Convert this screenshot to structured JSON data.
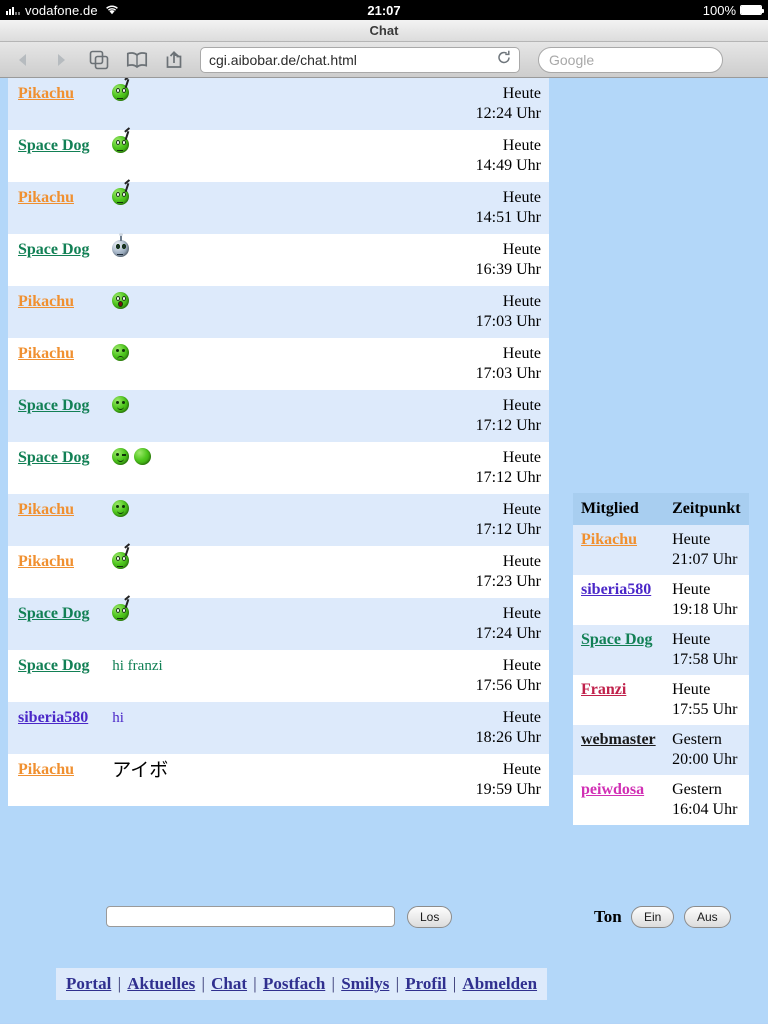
{
  "statusbar": {
    "carrier": "vodafone.de",
    "time": "21:07",
    "battery_percent": "100%",
    "signal_icon": "signal-bars-icon",
    "wifi_icon": "wifi-icon",
    "battery_icon": "battery-full-icon"
  },
  "browser": {
    "title": "Chat",
    "url": "cgi.aibobar.de/chat.html",
    "search_placeholder": "Google",
    "back_icon": "back-arrow-icon",
    "forward_icon": "forward-arrow-icon",
    "tabs_icon": "tabs-icon",
    "bookmarks_icon": "bookmarks-book-icon",
    "share_icon": "share-icon",
    "reload_icon": "reload-icon"
  },
  "chat": {
    "messages": [
      {
        "user": "Pikachu",
        "user_class": "u-pikachu",
        "smileys": [
          "wave"
        ],
        "text": "",
        "text_class": "",
        "day": "Heute",
        "time": "12:24 Uhr"
      },
      {
        "user": "Space Dog",
        "user_class": "u-spacedog",
        "smileys": [
          "wave"
        ],
        "text": "",
        "text_class": "",
        "day": "Heute",
        "time": "14:49 Uhr"
      },
      {
        "user": "Pikachu",
        "user_class": "u-pikachu",
        "smileys": [
          "wave"
        ],
        "text": "",
        "text_class": "",
        "day": "Heute",
        "time": "14:51 Uhr"
      },
      {
        "user": "Space Dog",
        "user_class": "u-spacedog",
        "smileys": [
          "robot"
        ],
        "text": "",
        "text_class": "",
        "day": "Heute",
        "time": "16:39 Uhr"
      },
      {
        "user": "Pikachu",
        "user_class": "u-pikachu",
        "smileys": [
          "shocked"
        ],
        "text": "",
        "text_class": "",
        "day": "Heute",
        "time": "17:03 Uhr"
      },
      {
        "user": "Pikachu",
        "user_class": "u-pikachu",
        "smileys": [
          "sad"
        ],
        "text": "",
        "text_class": "",
        "day": "Heute",
        "time": "17:03 Uhr"
      },
      {
        "user": "Space Dog",
        "user_class": "u-spacedog",
        "smileys": [
          "smile"
        ],
        "text": "",
        "text_class": "",
        "day": "Heute",
        "time": "17:12 Uhr"
      },
      {
        "user": "Space Dog",
        "user_class": "u-spacedog",
        "smileys": [
          "wink",
          "blank"
        ],
        "text": "",
        "text_class": "",
        "day": "Heute",
        "time": "17:12 Uhr"
      },
      {
        "user": "Pikachu",
        "user_class": "u-pikachu",
        "smileys": [
          "smile"
        ],
        "text": "",
        "text_class": "",
        "day": "Heute",
        "time": "17:12 Uhr"
      },
      {
        "user": "Pikachu",
        "user_class": "u-pikachu",
        "smileys": [
          "wave"
        ],
        "text": "",
        "text_class": "",
        "day": "Heute",
        "time": "17:23 Uhr"
      },
      {
        "user": "Space Dog",
        "user_class": "u-spacedog",
        "smileys": [
          "wave"
        ],
        "text": "",
        "text_class": "",
        "day": "Heute",
        "time": "17:24 Uhr"
      },
      {
        "user": "Space Dog",
        "user_class": "u-spacedog",
        "smileys": [],
        "text": "hi franzi",
        "text_class": "green",
        "day": "Heute",
        "time": "17:56 Uhr"
      },
      {
        "user": "siberia580",
        "user_class": "u-siberia",
        "smileys": [],
        "text": "hi",
        "text_class": "purple",
        "day": "Heute",
        "time": "18:26 Uhr"
      },
      {
        "user": "Pikachu",
        "user_class": "u-pikachu",
        "smileys": [],
        "text": "アイボ",
        "text_class": "jp",
        "day": "Heute",
        "time": "19:59 Uhr"
      }
    ]
  },
  "members": {
    "headers": {
      "member": "Mitglied",
      "time": "Zeitpunkt"
    },
    "rows": [
      {
        "name": "Pikachu",
        "name_class": "u-pikachu",
        "day": "Heute",
        "time": "21:07 Uhr"
      },
      {
        "name": "siberia580",
        "name_class": "u-siberia",
        "day": "Heute",
        "time": "19:18 Uhr"
      },
      {
        "name": "Space Dog",
        "name_class": "u-spacedog",
        "day": "Heute",
        "time": "17:58 Uhr"
      },
      {
        "name": "Franzi",
        "name_class": "u-franzi",
        "day": "Heute",
        "time": "17:55 Uhr"
      },
      {
        "name": "webmaster",
        "name_class": "u-webmaster",
        "day": "Gestern",
        "time": "20:00 Uhr"
      },
      {
        "name": "peiwdosa",
        "name_class": "u-peiwdosa",
        "day": "Gestern",
        "time": "16:04 Uhr"
      }
    ]
  },
  "controls": {
    "message_value": "",
    "message_placeholder": "",
    "send_label": "Los",
    "sound_label": "Ton",
    "sound_on_label": "Ein",
    "sound_off_label": "Aus"
  },
  "footer": {
    "links": [
      "Portal",
      "Aktuelles",
      "Chat",
      "Postfach",
      "Smilys",
      "Profil",
      "Abmelden"
    ],
    "separator": "|"
  },
  "colors": {
    "page_background": "#b3d7f9",
    "row_odd": "#ddeafb",
    "row_even": "#ffffff",
    "member_header": "#a8cef0",
    "pikachu": "#f09030",
    "spacedog": "#128055",
    "siberia580": "#4b28c8",
    "franzi": "#c0214b",
    "webmaster": "#1a1a1a",
    "peiwdosa": "#d12fb4"
  }
}
